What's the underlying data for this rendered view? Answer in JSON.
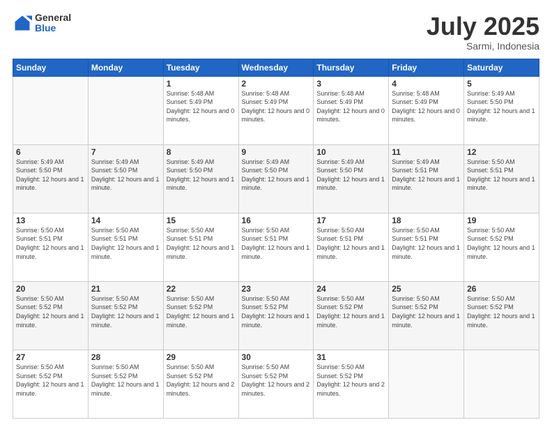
{
  "logo": {
    "general": "General",
    "blue": "Blue"
  },
  "header": {
    "month_year": "July 2025",
    "location": "Sarmi, Indonesia"
  },
  "weekdays": [
    "Sunday",
    "Monday",
    "Tuesday",
    "Wednesday",
    "Thursday",
    "Friday",
    "Saturday"
  ],
  "weeks": [
    [
      {
        "day": "",
        "info": ""
      },
      {
        "day": "",
        "info": ""
      },
      {
        "day": "1",
        "info": "Sunrise: 5:48 AM\nSunset: 5:49 PM\nDaylight: 12 hours and 0 minutes."
      },
      {
        "day": "2",
        "info": "Sunrise: 5:48 AM\nSunset: 5:49 PM\nDaylight: 12 hours and 0 minutes."
      },
      {
        "day": "3",
        "info": "Sunrise: 5:48 AM\nSunset: 5:49 PM\nDaylight: 12 hours and 0 minutes."
      },
      {
        "day": "4",
        "info": "Sunrise: 5:48 AM\nSunset: 5:49 PM\nDaylight: 12 hours and 0 minutes."
      },
      {
        "day": "5",
        "info": "Sunrise: 5:49 AM\nSunset: 5:50 PM\nDaylight: 12 hours and 1 minute."
      }
    ],
    [
      {
        "day": "6",
        "info": "Sunrise: 5:49 AM\nSunset: 5:50 PM\nDaylight: 12 hours and 1 minute."
      },
      {
        "day": "7",
        "info": "Sunrise: 5:49 AM\nSunset: 5:50 PM\nDaylight: 12 hours and 1 minute."
      },
      {
        "day": "8",
        "info": "Sunrise: 5:49 AM\nSunset: 5:50 PM\nDaylight: 12 hours and 1 minute."
      },
      {
        "day": "9",
        "info": "Sunrise: 5:49 AM\nSunset: 5:50 PM\nDaylight: 12 hours and 1 minute."
      },
      {
        "day": "10",
        "info": "Sunrise: 5:49 AM\nSunset: 5:50 PM\nDaylight: 12 hours and 1 minute."
      },
      {
        "day": "11",
        "info": "Sunrise: 5:49 AM\nSunset: 5:51 PM\nDaylight: 12 hours and 1 minute."
      },
      {
        "day": "12",
        "info": "Sunrise: 5:50 AM\nSunset: 5:51 PM\nDaylight: 12 hours and 1 minute."
      }
    ],
    [
      {
        "day": "13",
        "info": "Sunrise: 5:50 AM\nSunset: 5:51 PM\nDaylight: 12 hours and 1 minute."
      },
      {
        "day": "14",
        "info": "Sunrise: 5:50 AM\nSunset: 5:51 PM\nDaylight: 12 hours and 1 minute."
      },
      {
        "day": "15",
        "info": "Sunrise: 5:50 AM\nSunset: 5:51 PM\nDaylight: 12 hours and 1 minute."
      },
      {
        "day": "16",
        "info": "Sunrise: 5:50 AM\nSunset: 5:51 PM\nDaylight: 12 hours and 1 minute."
      },
      {
        "day": "17",
        "info": "Sunrise: 5:50 AM\nSunset: 5:51 PM\nDaylight: 12 hours and 1 minute."
      },
      {
        "day": "18",
        "info": "Sunrise: 5:50 AM\nSunset: 5:51 PM\nDaylight: 12 hours and 1 minute."
      },
      {
        "day": "19",
        "info": "Sunrise: 5:50 AM\nSunset: 5:52 PM\nDaylight: 12 hours and 1 minute."
      }
    ],
    [
      {
        "day": "20",
        "info": "Sunrise: 5:50 AM\nSunset: 5:52 PM\nDaylight: 12 hours and 1 minute."
      },
      {
        "day": "21",
        "info": "Sunrise: 5:50 AM\nSunset: 5:52 PM\nDaylight: 12 hours and 1 minute."
      },
      {
        "day": "22",
        "info": "Sunrise: 5:50 AM\nSunset: 5:52 PM\nDaylight: 12 hours and 1 minute."
      },
      {
        "day": "23",
        "info": "Sunrise: 5:50 AM\nSunset: 5:52 PM\nDaylight: 12 hours and 1 minute."
      },
      {
        "day": "24",
        "info": "Sunrise: 5:50 AM\nSunset: 5:52 PM\nDaylight: 12 hours and 1 minute."
      },
      {
        "day": "25",
        "info": "Sunrise: 5:50 AM\nSunset: 5:52 PM\nDaylight: 12 hours and 1 minute."
      },
      {
        "day": "26",
        "info": "Sunrise: 5:50 AM\nSunset: 5:52 PM\nDaylight: 12 hours and 1 minute."
      }
    ],
    [
      {
        "day": "27",
        "info": "Sunrise: 5:50 AM\nSunset: 5:52 PM\nDaylight: 12 hours and 1 minute."
      },
      {
        "day": "28",
        "info": "Sunrise: 5:50 AM\nSunset: 5:52 PM\nDaylight: 12 hours and 1 minute."
      },
      {
        "day": "29",
        "info": "Sunrise: 5:50 AM\nSunset: 5:52 PM\nDaylight: 12 hours and 2 minutes."
      },
      {
        "day": "30",
        "info": "Sunrise: 5:50 AM\nSunset: 5:52 PM\nDaylight: 12 hours and 2 minutes."
      },
      {
        "day": "31",
        "info": "Sunrise: 5:50 AM\nSunset: 5:52 PM\nDaylight: 12 hours and 2 minutes."
      },
      {
        "day": "",
        "info": ""
      },
      {
        "day": "",
        "info": ""
      }
    ]
  ]
}
